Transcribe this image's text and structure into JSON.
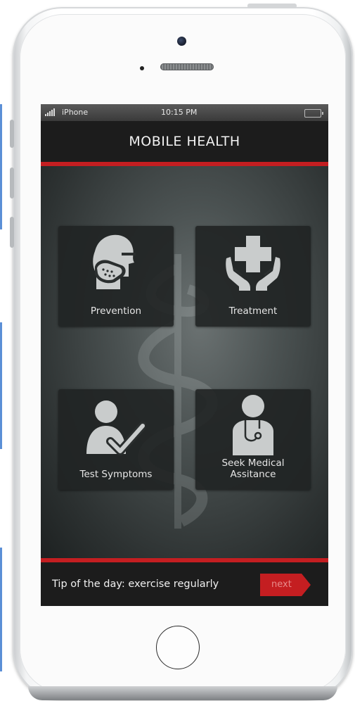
{
  "status_bar": {
    "carrier": "iPhone",
    "time": "10:15 PM"
  },
  "app": {
    "title": "MOBILE HEALTH"
  },
  "tiles": [
    {
      "label": "Prevention",
      "icon": "mask-person-icon"
    },
    {
      "label": "Treatment",
      "icon": "hands-cross-icon"
    },
    {
      "label": "Test Symptoms",
      "icon": "person-check-icon"
    },
    {
      "label": "Seek Medical Assitance",
      "icon": "doctor-icon"
    }
  ],
  "footer": {
    "tip": "Tip of the day: exercise regularly",
    "next_label": "next"
  },
  "colors": {
    "accent_red": "#c41e21",
    "header_bg": "#1c1c1c"
  }
}
